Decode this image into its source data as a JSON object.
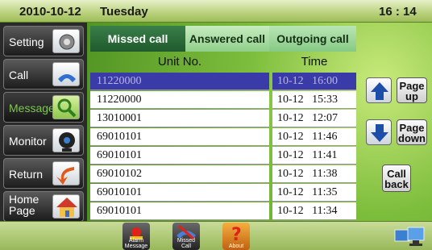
{
  "header": {
    "date": "2010-10-12",
    "day": "Tuesday",
    "time": "16 : 14"
  },
  "sidebar": {
    "items": [
      {
        "label": "Setting",
        "icon": "gear-icon"
      },
      {
        "label": "Call",
        "icon": "phone-icon"
      },
      {
        "label": "Message",
        "icon": "magnifier-icon"
      },
      {
        "label": "Monitor",
        "icon": "camera-icon"
      },
      {
        "label": "Return",
        "icon": "return-arrow-icon"
      },
      {
        "label_line1": "Home",
        "label_line2": "Page",
        "icon": "house-icon"
      }
    ]
  },
  "tabs": [
    "Missed call",
    "Answered call",
    "Outgoing call"
  ],
  "columns": {
    "unit": "Unit No.",
    "time": "Time"
  },
  "rows": [
    {
      "unit": "11220000",
      "time": "10-12   16:00"
    },
    {
      "unit": "11220000",
      "time": "10-12   15:33"
    },
    {
      "unit": "13010001",
      "time": "10-12   12:07"
    },
    {
      "unit": "69010101",
      "time": "10-12   11:46"
    },
    {
      "unit": "69010101",
      "time": "10-12   11:41"
    },
    {
      "unit": "69010102",
      "time": "10-12   11:38"
    },
    {
      "unit": "69010101",
      "time": "10-12   11:35"
    },
    {
      "unit": "69010101",
      "time": "10-12   11:34"
    }
  ],
  "buttons": {
    "page_up_1": "Page",
    "page_up_2": "up",
    "page_down_1": "Page",
    "page_down_2": "down",
    "call_back_1": "Call",
    "call_back_2": "back"
  },
  "bottom": {
    "alarm_1": "Alarm",
    "alarm_2": "Message",
    "missed_1": "Missed",
    "missed_2": "Call",
    "about": "About"
  },
  "colors": {
    "selected_row": "#3a3aa8",
    "accent_green": "#7ec850"
  }
}
